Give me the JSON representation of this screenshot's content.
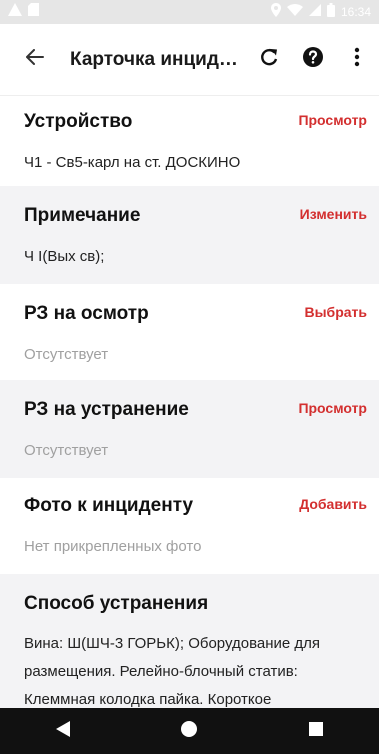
{
  "status_bar": {
    "time": "16:34"
  },
  "app_bar": {
    "title": "Карточка инцид…",
    "icons": [
      "back-arrow-icon",
      "refresh-icon",
      "help-icon",
      "more-vert-icon"
    ]
  },
  "sections": [
    {
      "title": "Устройство",
      "action": "Просмотр",
      "value": "Ч1 - Св5-карл на ст. ДОСКИНО",
      "muted": false
    },
    {
      "title": "Примечание",
      "action": "Изменить",
      "value": "Ч I(Вых св);",
      "muted": false
    },
    {
      "title": "РЗ на осмотр",
      "action": "Выбрать",
      "value": "Отсутствует",
      "muted": true
    },
    {
      "title": "РЗ на устранение",
      "action": "Просмотр",
      "value": "Отсутствует",
      "muted": true
    },
    {
      "title": "Фото к инциденту",
      "action": "Добавить",
      "value": "Нет прикрепленных фото",
      "muted": true
    },
    {
      "title": "Способ устранения",
      "action": "",
      "value": "Вина: Ш(ШЧ-3 ГОРЬК); Оборудование для размещения. Релейно-блочный статив: Клеммная колодка пайка. Короткое",
      "muted": false
    }
  ],
  "colors": {
    "accent": "#d32f2f",
    "gray_section": "#f3f3f5",
    "nav_bar": "#111111"
  }
}
